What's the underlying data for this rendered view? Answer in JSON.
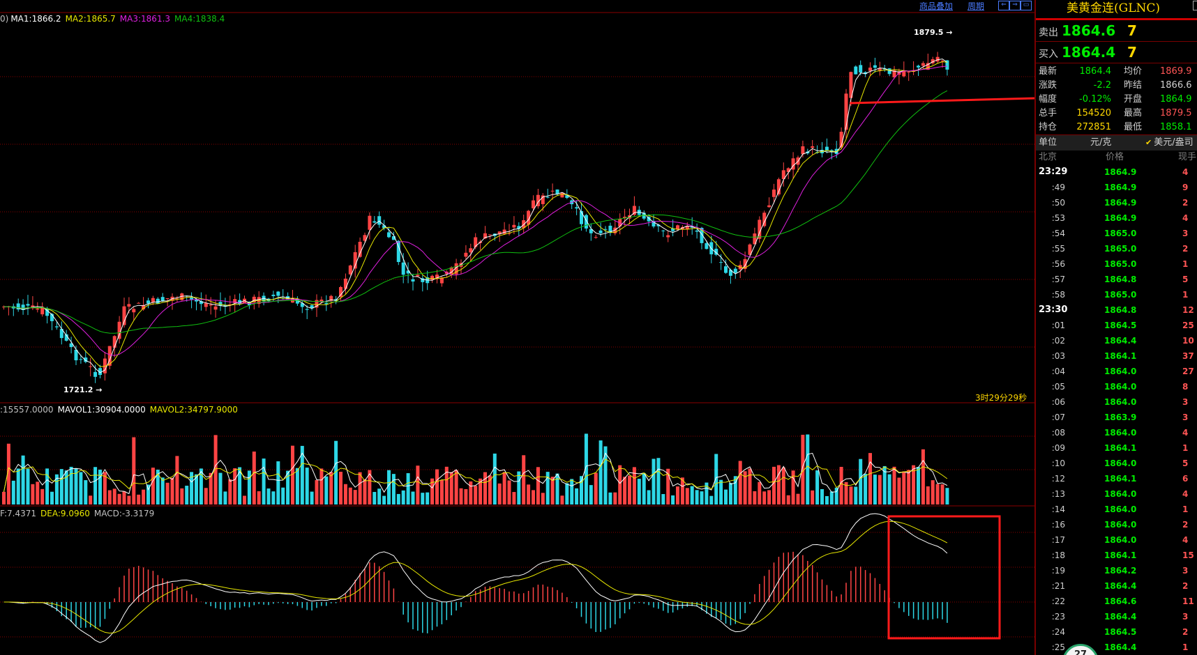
{
  "toolbar": {
    "overlay_label": "商品叠加",
    "period_label": "周期"
  },
  "price_legend": {
    "prefix": "0)",
    "ma1": "MA1:1866.2",
    "ma2": "MA2:1865.7",
    "ma3": "MA3:1861.3",
    "ma4": "MA4:1838.4"
  },
  "volume_legend": {
    "vol": ":15557.0000",
    "mavol1": "MAVOL1:30904.0000",
    "mavol2": "MAVOL2:34797.9000"
  },
  "macd_legend": {
    "dif": "F:7.4371",
    "dea": "DEA:9.0960",
    "macd": "MACD:-3.3179"
  },
  "annotations": {
    "high": "1879.5",
    "low": "1721.2",
    "countdown": "3时29分29秒"
  },
  "colors": {
    "up": "#ff4444",
    "down": "#2dd7e6",
    "ma1": "#ffffff",
    "ma2": "#e8e800",
    "ma3": "#e020e0",
    "ma4": "#10c010",
    "grid": "#8a0000",
    "highlight": "#ff1a1a"
  },
  "panel": {
    "title": "美黄金连(GLNC)",
    "sell_label": "卖出",
    "sell_price": "1864.6",
    "sell_vol": "7",
    "buy_label": "买入",
    "buy_price": "1864.4",
    "buy_vol": "7",
    "stats": [
      {
        "l1": "最新",
        "v1": "1864.4",
        "c1": "#00ee00",
        "l2": "均价",
        "v2": "1869.9",
        "c2": "#ff5555"
      },
      {
        "l1": "涨跌",
        "v1": "-2.2",
        "c1": "#00ee00",
        "l2": "昨结",
        "v2": "1866.6",
        "c2": "#d0d0d0"
      },
      {
        "l1": "幅度",
        "v1": "-0.12%",
        "c1": "#00ee00",
        "l2": "开盘",
        "v2": "1864.9",
        "c2": "#00ee00"
      },
      {
        "l1": "总手",
        "v1": "154520",
        "c1": "#ffd700",
        "l2": "最高",
        "v2": "1879.5",
        "c2": "#ff5555"
      },
      {
        "l1": "持仓",
        "v1": "272851",
        "c1": "#ffd700",
        "l2": "最低",
        "v2": "1858.1",
        "c2": "#00ee00"
      }
    ],
    "unit_label": "单位",
    "unit_value": "元/克",
    "unit_alt": "美元/盎司",
    "table_head": {
      "time": "北京",
      "price": "价格",
      "vol": "现手"
    },
    "ticks": [
      {
        "t": "23:29",
        "full": true,
        "p": "1864.9",
        "v": "4"
      },
      {
        "t": ":49",
        "full": false,
        "p": "1864.9",
        "v": "9"
      },
      {
        "t": ":50",
        "full": false,
        "p": "1864.9",
        "v": "2"
      },
      {
        "t": ":53",
        "full": false,
        "p": "1864.9",
        "v": "4"
      },
      {
        "t": ":54",
        "full": false,
        "p": "1865.0",
        "v": "3"
      },
      {
        "t": ":55",
        "full": false,
        "p": "1865.0",
        "v": "2"
      },
      {
        "t": ":56",
        "full": false,
        "p": "1865.0",
        "v": "1"
      },
      {
        "t": ":57",
        "full": false,
        "p": "1864.8",
        "v": "5"
      },
      {
        "t": ":58",
        "full": false,
        "p": "1865.0",
        "v": "1"
      },
      {
        "t": "23:30",
        "full": true,
        "p": "1864.8",
        "v": "12"
      },
      {
        "t": ":01",
        "full": false,
        "p": "1864.5",
        "v": "25"
      },
      {
        "t": ":02",
        "full": false,
        "p": "1864.4",
        "v": "10"
      },
      {
        "t": ":03",
        "full": false,
        "p": "1864.1",
        "v": "37"
      },
      {
        "t": ":04",
        "full": false,
        "p": "1864.0",
        "v": "27"
      },
      {
        "t": ":05",
        "full": false,
        "p": "1864.0",
        "v": "8"
      },
      {
        "t": ":06",
        "full": false,
        "p": "1864.0",
        "v": "3"
      },
      {
        "t": ":07",
        "full": false,
        "p": "1863.9",
        "v": "3"
      },
      {
        "t": ":08",
        "full": false,
        "p": "1864.0",
        "v": "4"
      },
      {
        "t": ":09",
        "full": false,
        "p": "1864.1",
        "v": "1"
      },
      {
        "t": ":10",
        "full": false,
        "p": "1864.0",
        "v": "5"
      },
      {
        "t": ":12",
        "full": false,
        "p": "1864.1",
        "v": "6"
      },
      {
        "t": ":13",
        "full": false,
        "p": "1864.0",
        "v": "4"
      },
      {
        "t": ":14",
        "full": false,
        "p": "1864.0",
        "v": "1"
      },
      {
        "t": ":16",
        "full": false,
        "p": "1864.0",
        "v": "2"
      },
      {
        "t": ":17",
        "full": false,
        "p": "1864.0",
        "v": "4"
      },
      {
        "t": ":18",
        "full": false,
        "p": "1864.1",
        "v": "15"
      },
      {
        "t": ":19",
        "full": false,
        "p": "1864.2",
        "v": "3"
      },
      {
        "t": ":21",
        "full": false,
        "p": "1864.4",
        "v": "2"
      },
      {
        "t": ":22",
        "full": false,
        "p": "1864.6",
        "v": "11"
      },
      {
        "t": ":23",
        "full": false,
        "p": "1864.4",
        "v": "3"
      },
      {
        "t": ":24",
        "full": false,
        "p": "1864.5",
        "v": "2"
      },
      {
        "t": ":25",
        "full": false,
        "p": "1864.4",
        "v": "1"
      }
    ],
    "float_label": "27"
  }
}
